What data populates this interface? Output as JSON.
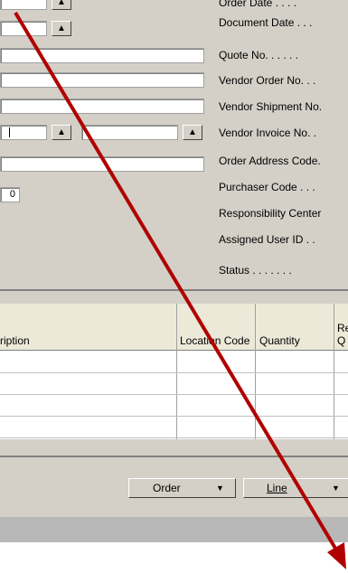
{
  "labels": {
    "order_date": "Order Date . . . .",
    "document_date": "Document Date . . .",
    "quote_no": "Quote No. . . . . .",
    "vendor_order_no": "Vendor Order No. . .",
    "vendor_shipment_no": "Vendor Shipment No.",
    "vendor_invoice_no": "Vendor Invoice No. .",
    "order_address_code": "Order Address Code.",
    "purchaser_code": "Purchaser Code . . .",
    "responsibility_center": "Responsibility Center",
    "assigned_user_id": "Assigned User ID . .",
    "status": "Status . . . . . . ."
  },
  "fields": {
    "count_value": "0",
    "dropdown_glyph": "▲"
  },
  "grid": {
    "columns": {
      "description": "ription",
      "location_code": "Location Code",
      "quantity": "Quantity",
      "next": "Re Q"
    }
  },
  "buttons": {
    "order": "Order",
    "line": "Line"
  },
  "colors": {
    "form_bg": "#d4d0c8",
    "arrow": "#b00000"
  }
}
